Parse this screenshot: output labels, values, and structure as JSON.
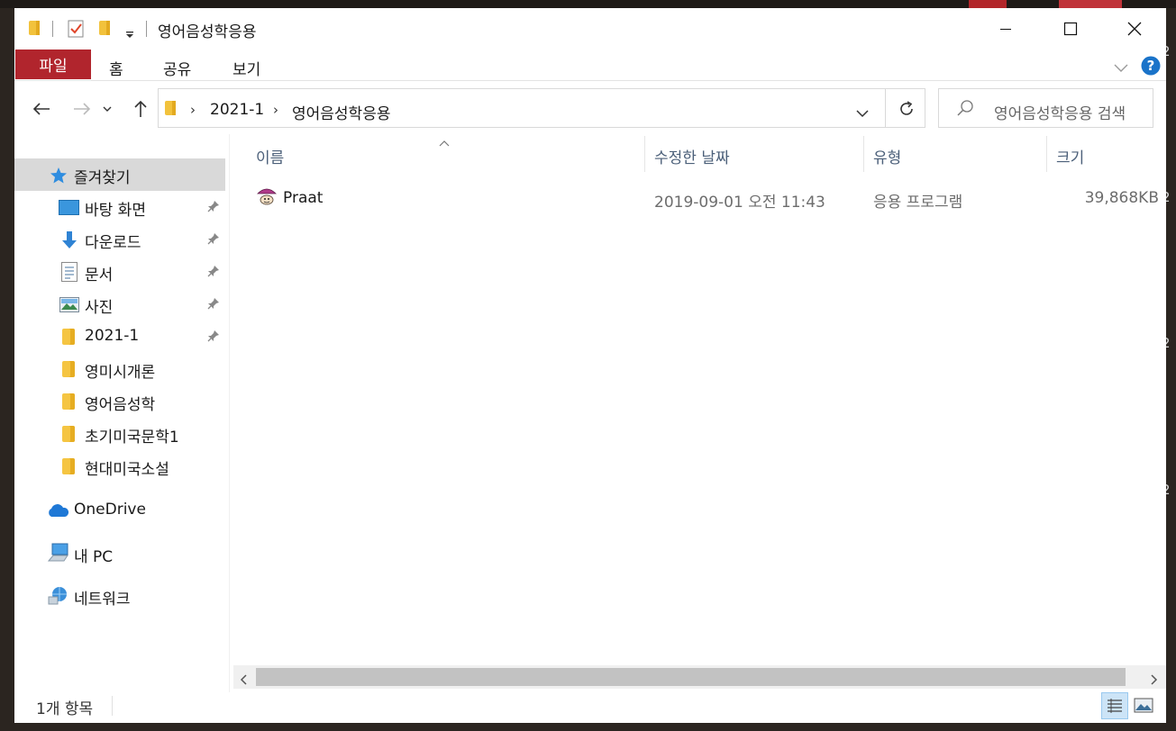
{
  "window": {
    "title": "영어음성학응용",
    "controls": {
      "minimize": "minimize-icon",
      "maximize": "maximize-icon",
      "close": "close-icon"
    }
  },
  "ribbon": {
    "file_tab": "파일",
    "tabs": [
      "홈",
      "공유",
      "보기"
    ]
  },
  "address": {
    "breadcrumb": [
      "2021-1",
      "영어음성학응용"
    ]
  },
  "search": {
    "placeholder": "영어음성학응용 검색"
  },
  "sidebar": {
    "quick_access": "즐겨찾기",
    "items": [
      {
        "label": "바탕 화면",
        "icon": "desktop-icon",
        "pinned": true
      },
      {
        "label": "다운로드",
        "icon": "download-icon",
        "pinned": true
      },
      {
        "label": "문서",
        "icon": "document-icon",
        "pinned": true
      },
      {
        "label": "사진",
        "icon": "pictures-icon",
        "pinned": true
      },
      {
        "label": "2021-1",
        "icon": "folder-icon",
        "pinned": true
      },
      {
        "label": "영미시개론",
        "icon": "folder-icon",
        "pinned": false
      },
      {
        "label": "영어음성학",
        "icon": "folder-icon",
        "pinned": false
      },
      {
        "label": "초기미국문학1",
        "icon": "folder-icon",
        "pinned": false
      },
      {
        "label": "현대미국소설",
        "icon": "folder-icon",
        "pinned": false
      }
    ],
    "onedrive": "OneDrive",
    "this_pc": "내 PC",
    "network": "네트워크"
  },
  "columns": {
    "name": "이름",
    "modified": "수정한 날짜",
    "type": "유형",
    "size": "크기"
  },
  "files": [
    {
      "name": "Praat",
      "modified": "2019-09-01 오전 11:43",
      "type": "응용 프로그램",
      "size": "39,868KB"
    }
  ],
  "status": {
    "count": "1개 항목"
  },
  "colors": {
    "file_tab": "#b1252d",
    "selected_nav": "#d9d9d9",
    "accent": "#0067c0"
  }
}
